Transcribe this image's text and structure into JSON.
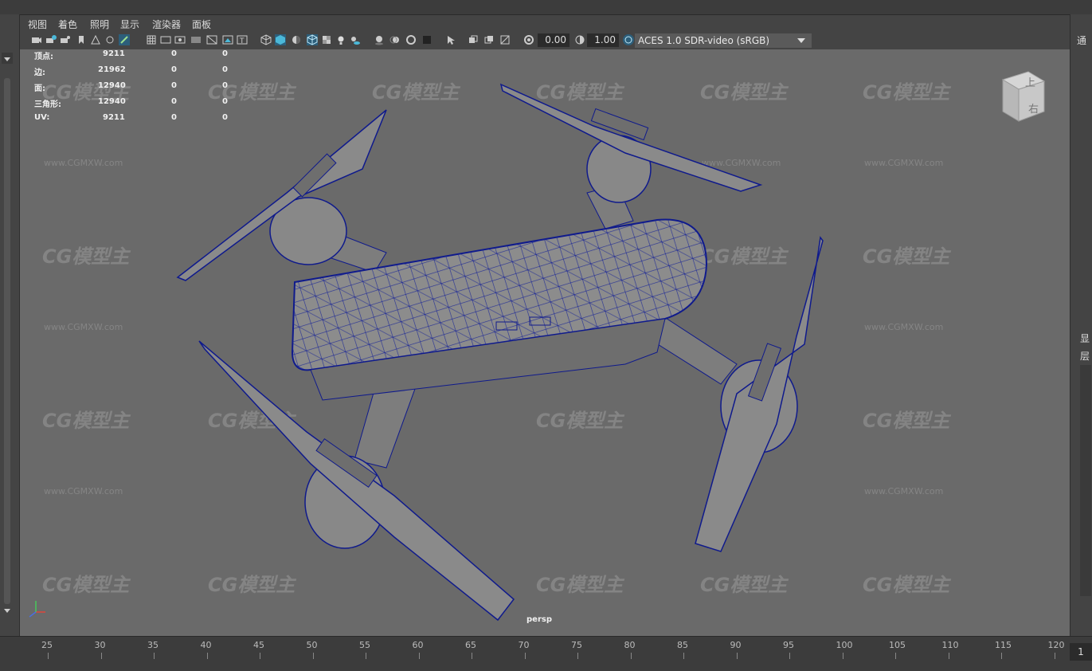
{
  "menu": [
    "视图",
    "着色",
    "照明",
    "显示",
    "渲染器",
    "面板"
  ],
  "toolbar": {
    "exposure": "0.00",
    "gamma": "1.00",
    "color_space": "ACES 1.0 SDR-video (sRGB)"
  },
  "stats": [
    {
      "label": "顶点:",
      "value": "9211",
      "a": "0",
      "b": "0"
    },
    {
      "label": "边:",
      "value": "21962",
      "a": "0",
      "b": "0"
    },
    {
      "label": "面:",
      "value": "12940",
      "a": "0",
      "b": "0"
    },
    {
      "label": "三角形:",
      "value": "12940",
      "a": "0",
      "b": "0"
    },
    {
      "label": "UV:",
      "value": "9211",
      "a": "0",
      "b": "0"
    }
  ],
  "viewport": {
    "camera": "persp",
    "viewcube_top": "上",
    "viewcube_right": "右"
  },
  "right_panel": [
    "通",
    "显",
    "层"
  ],
  "watermark": {
    "logo": "CG模型主",
    "url": "www.CGMXW.com"
  },
  "timeline": {
    "ticks": [
      "25",
      "30",
      "35",
      "40",
      "45",
      "50",
      "55",
      "60",
      "65",
      "70",
      "75",
      "80",
      "85",
      "90",
      "95",
      "100",
      "105",
      "110",
      "115",
      "120"
    ],
    "current_frame": "1"
  },
  "colors": {
    "wire": "#0f1a8c",
    "viewport_bg": "#6a6a6a",
    "model": "#8a8a8a"
  }
}
